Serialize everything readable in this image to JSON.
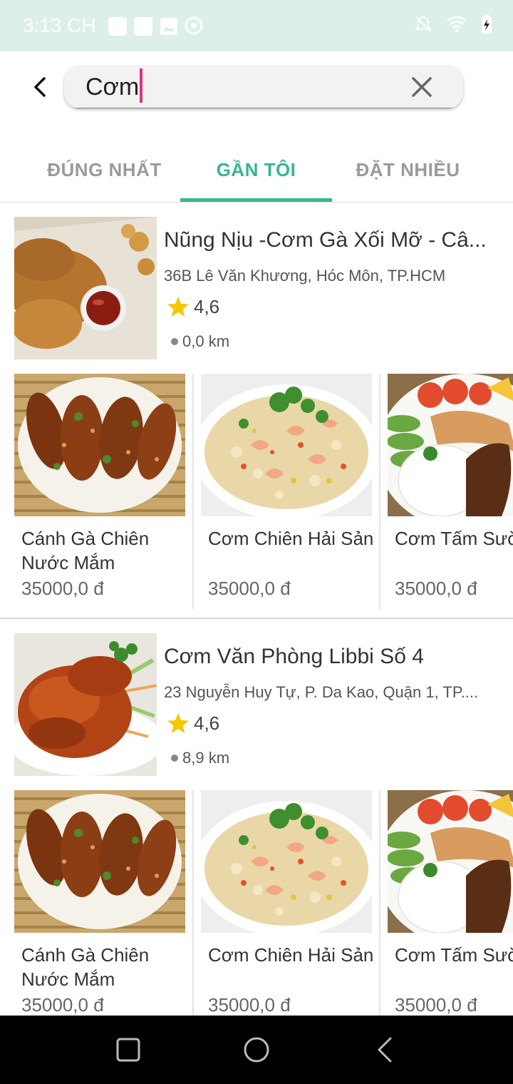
{
  "status_bar": {
    "time": "3:13 CH"
  },
  "search": {
    "value": "Cơm"
  },
  "tabs": [
    {
      "label": "ĐÚNG NHẤT"
    },
    {
      "label": "GẦN TÔI"
    },
    {
      "label": "ĐẶT NHIỀU"
    }
  ],
  "restaurants": [
    {
      "name": "Nũng Nịu -Cơm Gà Xối Mỡ - Câ...",
      "address": "36B Lê Văn Khương, Hóc Môn, TP.HCM",
      "rating": "4,6",
      "distance": "0,0 km",
      "dishes": [
        {
          "name": "Cánh Gà Chiên Nước Mắm",
          "price": "35000,0 đ"
        },
        {
          "name": "Cơm Chiên Hải Sản",
          "price": "35000,0 đ"
        },
        {
          "name": "Cơm Tấm Sườn Chả",
          "price": "35000,0 đ"
        }
      ]
    },
    {
      "name": "Cơm Văn Phòng Libbi Số 4",
      "address": "23 Nguyễn Huy Tự, P. Da Kao, Quận 1, TP....",
      "rating": "4,6",
      "distance": "8,9 km",
      "dishes": [
        {
          "name": "Cánh Gà Chiên Nước Mắm",
          "price": "35000,0 đ"
        },
        {
          "name": "Cơm Chiên Hải Sản",
          "price": "35000,0 đ"
        },
        {
          "name": "Cơm Tấm Sườn Chả",
          "price": "35000,0 đ"
        }
      ]
    }
  ],
  "colors": {
    "accent": "#35b78f",
    "caret": "#e2317c",
    "star": "#f7c600",
    "status_bar": "#dcefe8"
  },
  "icons": [
    "back-arrow-icon",
    "close-icon",
    "star-icon",
    "square-nav-icon",
    "circle-nav-icon",
    "triangle-back-icon"
  ]
}
